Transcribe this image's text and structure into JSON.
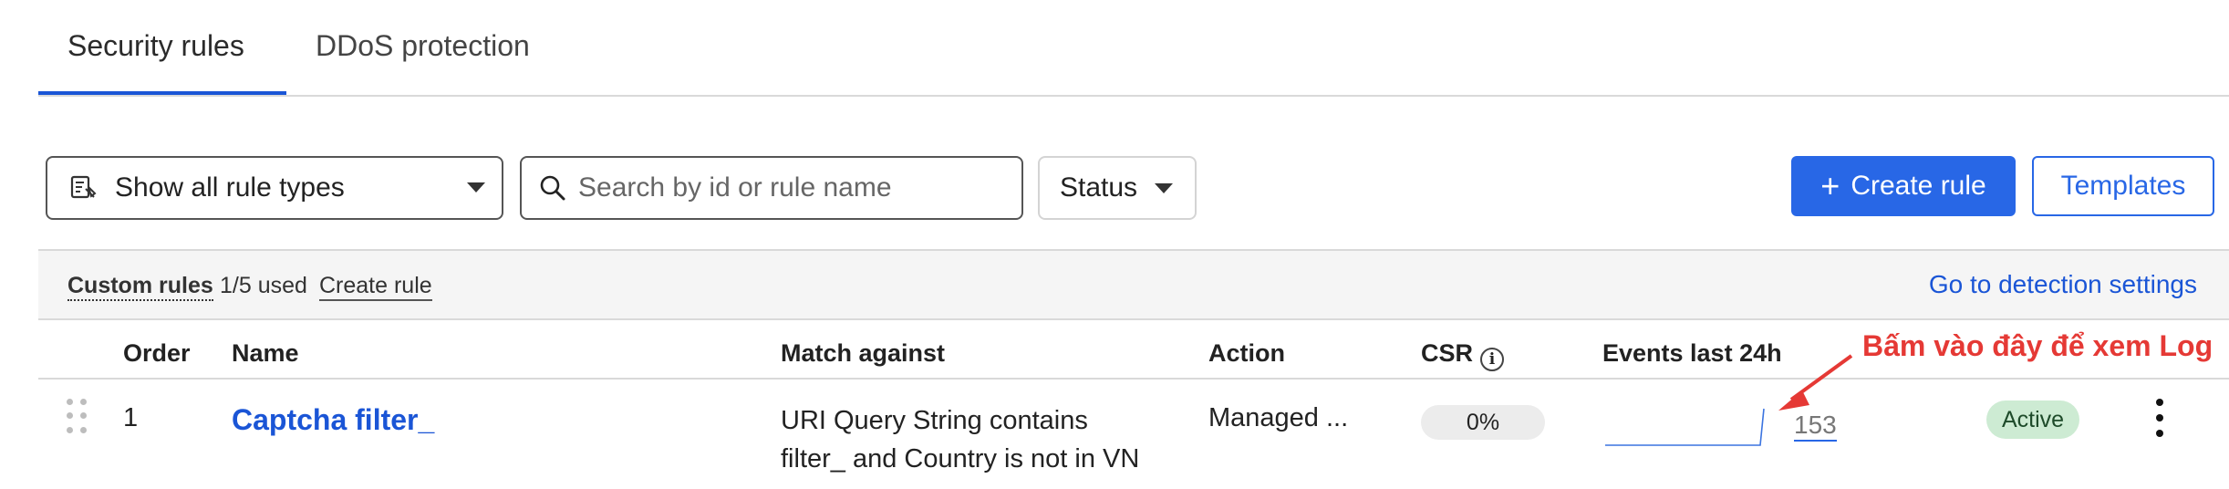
{
  "tabs": [
    {
      "label": "Security rules",
      "active": true
    },
    {
      "label": "DDoS protection",
      "active": false
    }
  ],
  "toolbar": {
    "rule_type_select": "Show all rule types",
    "search_placeholder": "Search by id or rule name",
    "status_label": "Status",
    "create_rule_label": "Create rule",
    "templates_label": "Templates"
  },
  "custom_rules_bar": {
    "title": "Custom rules",
    "usage": "1/5 used",
    "create_link": "Create rule",
    "detection_link": "Go to detection settings"
  },
  "table": {
    "columns": [
      "Order",
      "Name",
      "Match against",
      "Action",
      "CSR",
      "Events last 24h"
    ],
    "rows": [
      {
        "order": "1",
        "name": "Captcha filter_",
        "match_line1": "URI Query String contains",
        "match_line2": "filter_ and Country is not in VN",
        "action": "Managed ...",
        "csr": "0%",
        "events": "153",
        "status": "Active"
      }
    ]
  },
  "annotation": {
    "text": "Bấm vào đây để xem Log",
    "color": "#e53935"
  },
  "colors": {
    "accent": "#2867e6",
    "link": "#1a55d6",
    "active_badge_bg": "#cdebd3"
  },
  "icons": {
    "rule_type": "rule-list-icon",
    "search": "search-icon",
    "create": "plus-icon",
    "csr_info": "info-icon",
    "drag": "drag-handle-icon",
    "more": "kebab-menu-icon"
  }
}
